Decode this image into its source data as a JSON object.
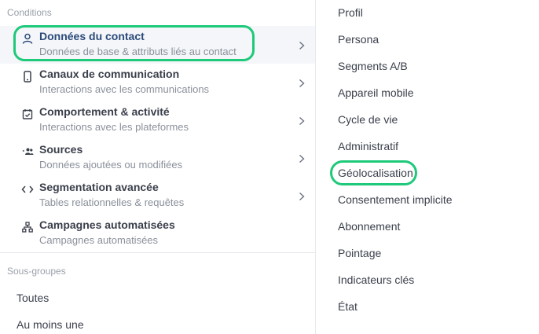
{
  "conditions": {
    "label": "Conditions",
    "items": [
      {
        "title": "Données du contact",
        "subtitle": "Données de base & attributs liés au contact",
        "icon": "user-icon",
        "has_chevron": true,
        "active": true
      },
      {
        "title": "Canaux de communication",
        "subtitle": "Interactions avec les communications",
        "icon": "mobile-icon",
        "has_chevron": true,
        "active": false
      },
      {
        "title": "Comportement & activité",
        "subtitle": "Interactions avec les plateformes",
        "icon": "calendar-check-icon",
        "has_chevron": true,
        "active": false
      },
      {
        "title": "Sources",
        "subtitle": "Données ajoutées ou modifiées",
        "icon": "sources-icon",
        "has_chevron": true,
        "active": false
      },
      {
        "title": "Segmentation avancée",
        "subtitle": "Tables relationnelles & requêtes",
        "icon": "code-icon",
        "has_chevron": true,
        "active": false
      },
      {
        "title": "Campagnes automatisées",
        "subtitle": "Campagnes automatisées",
        "icon": "sitemap-icon",
        "has_chevron": false,
        "active": false
      }
    ]
  },
  "subgroups": {
    "label": "Sous-groupes",
    "items": [
      "Toutes",
      "Au moins une"
    ]
  },
  "attributes": {
    "items": [
      "Profil",
      "Persona",
      "Segments A/B",
      "Appareil mobile",
      "Cycle de vie",
      "Administratif",
      "Géolocalisation",
      "Consentement implicite",
      "Abonnement",
      "Pointage",
      "Indicateurs clés",
      "État"
    ],
    "highlighted": "Géolocalisation"
  },
  "colors": {
    "highlight": "#1ec97a",
    "active_bg": "#f4f6f9",
    "active_title": "#2a4a7a"
  }
}
